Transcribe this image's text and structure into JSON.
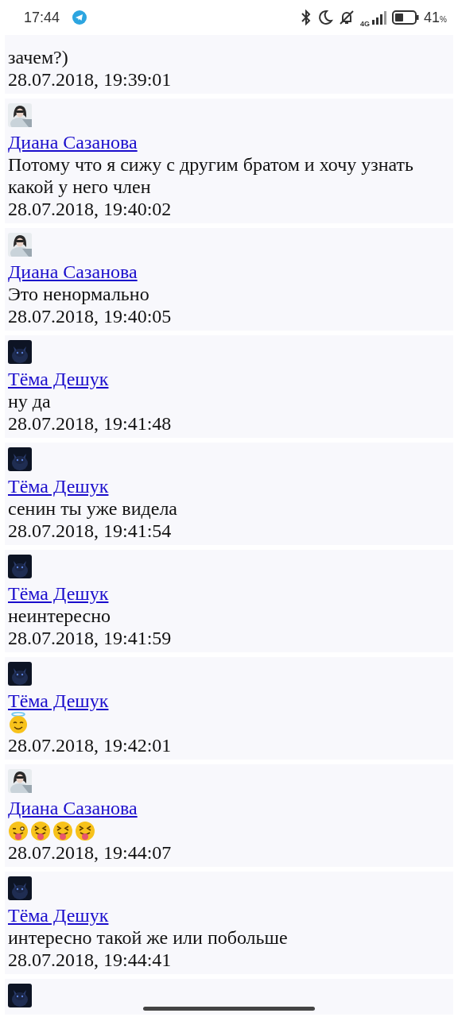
{
  "status_bar": {
    "time": "17:44",
    "network": "4G",
    "battery": "41",
    "battery_unit": "%"
  },
  "messages": [
    {
      "text": "зачем?)",
      "date": "28.07.2018, 19:39:01"
    },
    {
      "author": "Диана Сазанова",
      "avatar": {
        "kind": "light"
      },
      "text": "Потому что я сижу с другим братом и хочу узнать какой у него член",
      "date": "28.07.2018, 19:40:02"
    },
    {
      "author": "Диана Сазанова",
      "avatar": {
        "kind": "light"
      },
      "text": "Это ненормально",
      "date": "28.07.2018, 19:40:05"
    },
    {
      "author": "Тёма Дешук",
      "avatar": {
        "kind": "dark"
      },
      "text": "ну да",
      "date": "28.07.2018, 19:41:48"
    },
    {
      "author": "Тёма Дешук",
      "avatar": {
        "kind": "dark"
      },
      "text": "сенин ты уже видела",
      "date": "28.07.2018, 19:41:54"
    },
    {
      "author": "Тёма Дешук",
      "avatar": {
        "kind": "dark"
      },
      "text": "неинтересно",
      "date": "28.07.2018, 19:41:59"
    },
    {
      "author": "Тёма Дешук",
      "avatar": {
        "kind": "dark"
      },
      "emoji": [
        {
          "kind": "halo"
        }
      ],
      "date": "28.07.2018, 19:42:01"
    },
    {
      "author": "Диана Сазанова",
      "avatar": {
        "kind": "light"
      },
      "emoji": [
        {
          "kind": "wink-tongue"
        },
        {
          "kind": "squint-tongue"
        },
        {
          "kind": "squint-tongue"
        },
        {
          "kind": "squint-tongue"
        }
      ],
      "date": "28.07.2018, 19:44:07"
    },
    {
      "author": "Тёма Дешук",
      "avatar": {
        "kind": "dark"
      },
      "text": "интересно такой же или побольше",
      "date": "28.07.2018, 19:44:41"
    },
    {
      "avatar": {
        "kind": "dark"
      }
    }
  ]
}
